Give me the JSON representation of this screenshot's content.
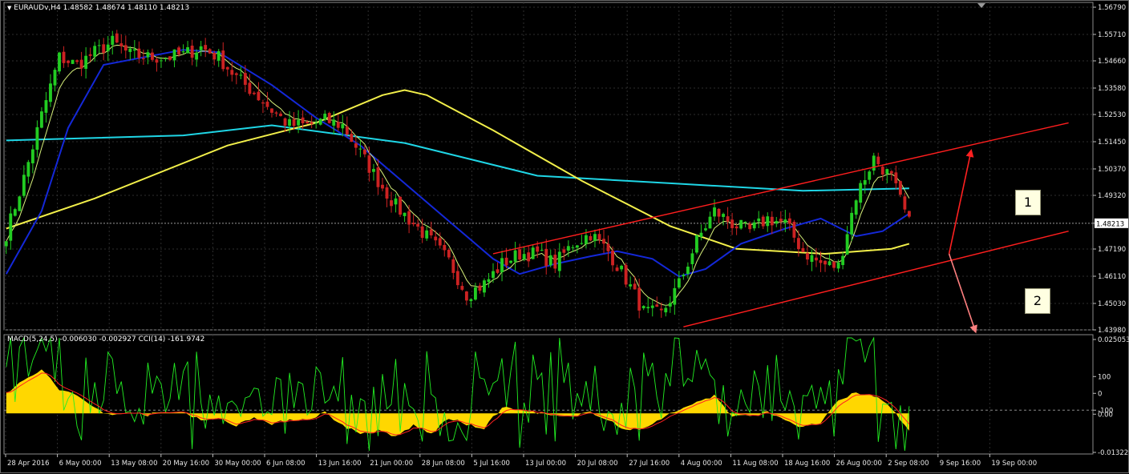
{
  "header": {
    "symbol": "EURAUDv,H4",
    "ohlc": "1.48582 1.48674 1.48110 1.48213"
  },
  "indicator_header": {
    "macd": "MACD(5,24,5) -0.006030 -0.002927",
    "cci": "CCI(14) -161.9742"
  },
  "price_tag": "1.48213",
  "callouts": [
    "1",
    "2"
  ],
  "colors": {
    "background": "#000000",
    "grid": "#2e2e2e",
    "bull": "#22cc22",
    "bear": "#cc2222",
    "ma_blue": "#1428d8",
    "ma_cyan": "#1fd6e6",
    "ma_yellow": "#f2ef4a",
    "ma_fast": "#d7f07a",
    "channel": "#ff1e1e",
    "arrow_up": "#ff2020",
    "arrow_down": "#ff8080",
    "macd_hist": "#ffd700",
    "macd_signal": "#ff2020",
    "cci": "#22ee22"
  },
  "chart_data": [
    {
      "type": "candlestick",
      "title": "EURAUDv,H4",
      "ylim": [
        1.4398,
        1.5679
      ],
      "y_ticks": [
        "1.56790",
        "1.55710",
        "1.54660",
        "1.53580",
        "1.52530",
        "1.51450",
        "1.50370",
        "1.49320",
        "1.48213",
        "1.47190",
        "1.46110",
        "1.45030",
        "1.43980"
      ],
      "x_ticks": [
        "28 Apr 2016",
        "6 May 00:00",
        "13 May 08:00",
        "20 May 16:00",
        "30 May 00:00",
        "6 Jun 08:00",
        "13 Jun 16:00",
        "21 Jun 00:00",
        "28 Jun 08:00",
        "5 Jul 16:00",
        "13 Jul 00:00",
        "20 Jul 08:00",
        "27 Jul 16:00",
        "4 Aug 00:00",
        "11 Aug 08:00",
        "18 Aug 16:00",
        "26 Aug 00:00",
        "2 Sep 08:00",
        "9 Sep 16:00",
        "19 Sep 00:00"
      ],
      "last_price": 1.48213,
      "close_path": [
        [
          0,
          1.478
        ],
        [
          4,
          1.5
        ],
        [
          8,
          1.525
        ],
        [
          12,
          1.548
        ],
        [
          16,
          1.545
        ],
        [
          20,
          1.55
        ],
        [
          24,
          1.554
        ],
        [
          28,
          1.549
        ],
        [
          32,
          1.548
        ],
        [
          36,
          1.548
        ],
        [
          40,
          1.549
        ],
        [
          44,
          1.552
        ],
        [
          48,
          1.548
        ],
        [
          52,
          1.54
        ],
        [
          56,
          1.534
        ],
        [
          60,
          1.527
        ],
        [
          64,
          1.521
        ],
        [
          68,
          1.521
        ],
        [
          72,
          1.523
        ],
        [
          76,
          1.521
        ],
        [
          80,
          1.51
        ],
        [
          84,
          1.499
        ],
        [
          88,
          1.489
        ],
        [
          92,
          1.482
        ],
        [
          96,
          1.475
        ],
        [
          100,
          1.467
        ],
        [
          104,
          1.454
        ],
        [
          108,
          1.458
        ],
        [
          112,
          1.466
        ],
        [
          116,
          1.47
        ],
        [
          120,
          1.47
        ],
        [
          124,
          1.466
        ],
        [
          128,
          1.474
        ],
        [
          132,
          1.478
        ],
        [
          136,
          1.471
        ],
        [
          140,
          1.46
        ],
        [
          144,
          1.447
        ],
        [
          148,
          1.446
        ],
        [
          152,
          1.458
        ],
        [
          156,
          1.475
        ],
        [
          160,
          1.487
        ],
        [
          164,
          1.482
        ],
        [
          168,
          1.479
        ],
        [
          172,
          1.484
        ],
        [
          176,
          1.482
        ],
        [
          180,
          1.471
        ],
        [
          184,
          1.466
        ],
        [
          188,
          1.465
        ],
        [
          192,
          1.493
        ],
        [
          196,
          1.508
        ],
        [
          200,
          1.5
        ],
        [
          204,
          1.482
        ]
      ],
      "series": [
        {
          "name": "",
          "color": "#1fd6e6",
          "points": [
            [
              0,
              1.515
            ],
            [
              40,
              1.517
            ],
            [
              60,
              1.521
            ],
            [
              90,
              1.514
            ],
            [
              120,
              1.501
            ],
            [
              150,
              1.498
            ],
            [
              180,
              1.495
            ],
            [
              204,
              1.496
            ]
          ]
        },
        {
          "name": "",
          "color": "#f2ef4a",
          "points": [
            [
              0,
              1.48
            ],
            [
              20,
              1.492
            ],
            [
              50,
              1.513
            ],
            [
              70,
              1.522
            ],
            [
              85,
              1.533
            ],
            [
              90,
              1.535
            ],
            [
              95,
              1.533
            ],
            [
              110,
              1.519
            ],
            [
              130,
              1.499
            ],
            [
              150,
              1.481
            ],
            [
              165,
              1.472
            ],
            [
              185,
              1.47
            ],
            [
              200,
              1.472
            ],
            [
              204,
              1.474
            ]
          ]
        },
        {
          "name": "",
          "color": "#1428d8",
          "points": [
            [
              0,
              1.462
            ],
            [
              8,
              1.487
            ],
            [
              14,
              1.52
            ],
            [
              22,
              1.545
            ],
            [
              40,
              1.551
            ],
            [
              48,
              1.55
            ],
            [
              60,
              1.537
            ],
            [
              70,
              1.524
            ],
            [
              80,
              1.513
            ],
            [
              90,
              1.498
            ],
            [
              100,
              1.483
            ],
            [
              110,
              1.468
            ],
            [
              116,
              1.462
            ],
            [
              124,
              1.466
            ],
            [
              132,
              1.469
            ],
            [
              138,
              1.471
            ],
            [
              146,
              1.468
            ],
            [
              152,
              1.461
            ],
            [
              158,
              1.464
            ],
            [
              166,
              1.474
            ],
            [
              176,
              1.48
            ],
            [
              184,
              1.484
            ],
            [
              192,
              1.477
            ],
            [
              198,
              1.479
            ],
            [
              204,
              1.486
            ]
          ]
        }
      ],
      "channel": [
        [
          [
            110,
            1.47
          ],
          [
            240,
            1.522
          ]
        ],
        [
          [
            153,
            1.441
          ],
          [
            240,
            1.479
          ]
        ]
      ],
      "projections": [
        {
          "label": "1",
          "from": [
            213,
            1.47
          ],
          "to": [
            218,
            1.511
          ]
        },
        {
          "label": "2",
          "from": [
            213,
            1.47
          ],
          "to": [
            219,
            1.439
          ]
        }
      ]
    },
    {
      "type": "area",
      "title": "MACD(5,24,5) -0.006030 -0.002927 CCI(14) -161.9742",
      "ylim": [
        -0.013229,
        0.025053
      ],
      "y_ticks": [
        "0.025053",
        "100",
        "0",
        "-100",
        "0.00",
        "-0.013229"
      ],
      "macd_path": [
        [
          0,
          0.007
        ],
        [
          4,
          0.011
        ],
        [
          8,
          0.015
        ],
        [
          12,
          0.008
        ],
        [
          16,
          0.006
        ],
        [
          20,
          0.002
        ],
        [
          24,
          -0.001
        ],
        [
          28,
          0.0008
        ],
        [
          32,
          -0.0005
        ],
        [
          36,
          0.0003
        ],
        [
          40,
          0.0005
        ],
        [
          44,
          -0.002
        ],
        [
          48,
          -0.002
        ],
        [
          52,
          -0.004
        ],
        [
          56,
          -0.001
        ],
        [
          60,
          -0.004
        ],
        [
          64,
          -0.002
        ],
        [
          68,
          -0.002
        ],
        [
          72,
          0.0003
        ],
        [
          76,
          -0.004
        ],
        [
          80,
          -0.007
        ],
        [
          84,
          -0.006
        ],
        [
          88,
          -0.008
        ],
        [
          92,
          -0.004
        ],
        [
          96,
          -0.007
        ],
        [
          100,
          -0.0015
        ],
        [
          104,
          -0.004
        ],
        [
          108,
          -0.005
        ],
        [
          112,
          0.002
        ],
        [
          116,
          0.001
        ],
        [
          120,
          0.0003
        ],
        [
          124,
          -0.001
        ],
        [
          128,
          -0.0015
        ],
        [
          132,
          0.0006
        ],
        [
          136,
          -0.002
        ],
        [
          140,
          -0.006
        ],
        [
          144,
          -0.005
        ],
        [
          148,
          -0.0015
        ],
        [
          152,
          0.001
        ],
        [
          156,
          0.004
        ],
        [
          160,
          0.006
        ],
        [
          164,
          -0.001
        ],
        [
          168,
          -0.001
        ],
        [
          172,
          0.0005
        ],
        [
          176,
          -0.002
        ],
        [
          180,
          -0.005
        ],
        [
          184,
          -0.003
        ],
        [
          188,
          0.004
        ],
        [
          192,
          0.007
        ],
        [
          196,
          0.006
        ],
        [
          200,
          0.002
        ],
        [
          204,
          -0.006
        ]
      ]
    }
  ]
}
